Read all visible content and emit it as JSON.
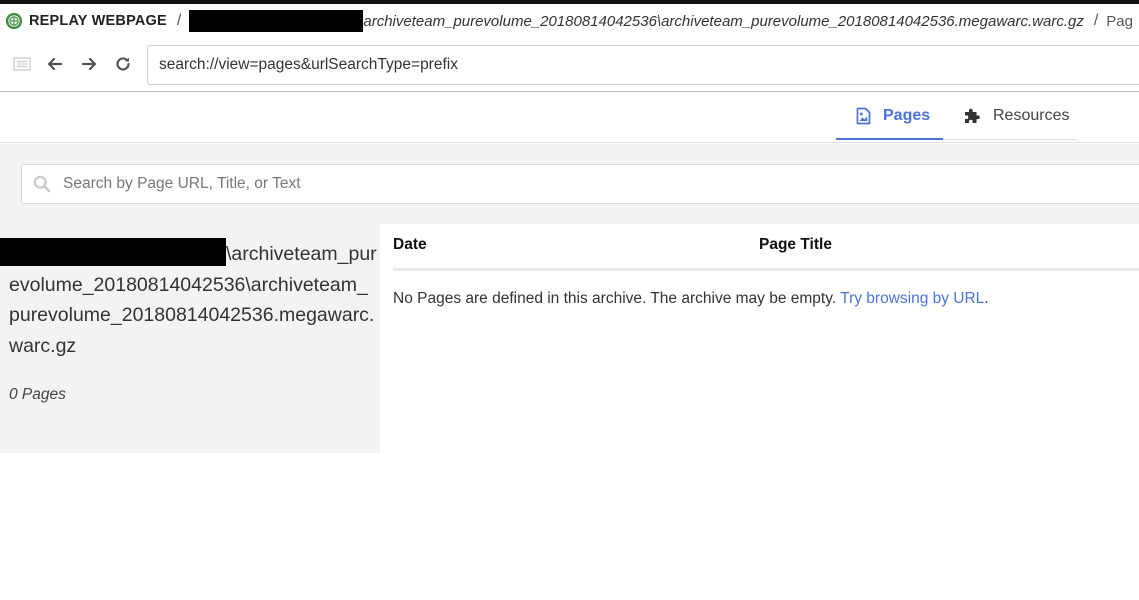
{
  "app": {
    "name": "REPLAY WEBPAGE"
  },
  "breadcrumb": {
    "separator": "/",
    "path": "archiveteam_purevolume_20180814042536\\archiveteam_purevolume_20180814042536.megawarc.warc.gz",
    "next": "Pag"
  },
  "nav": {
    "url": "search://view=pages&urlSearchType=prefix"
  },
  "tabs": [
    {
      "label": "Pages",
      "active": true
    },
    {
      "label": "Resources",
      "active": false
    }
  ],
  "search": {
    "placeholder": "Search by Page URL, Title, or Text"
  },
  "collection": {
    "title_first": "\\archiveteam_pur",
    "title_rest": "evolume_20180814042536\\archiveteam_purevolume_20180814042536.megawarc.warc.gz",
    "page_count": "0 Pages"
  },
  "table": {
    "columns": [
      "Date",
      "Page Title"
    ],
    "empty_message": "No Pages are defined in this archive. The archive may be empty.",
    "empty_link": "Try browsing by URL",
    "empty_suffix": "."
  },
  "colors": {
    "accent": "#4a74d9",
    "logo": "#3f8f3f"
  }
}
